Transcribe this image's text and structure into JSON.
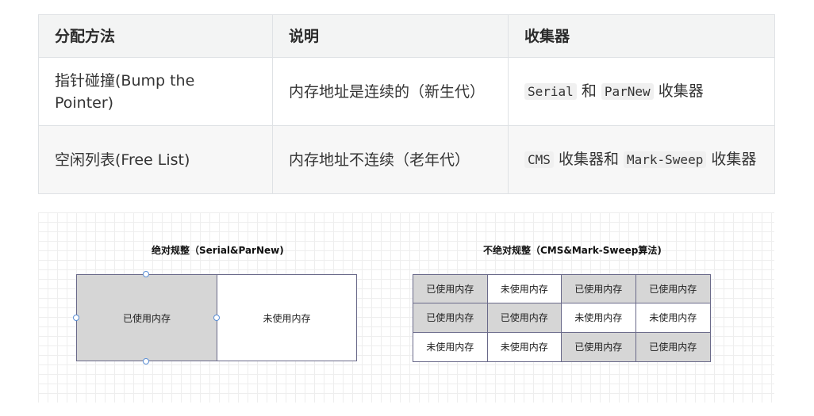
{
  "table": {
    "headers": [
      "分配方法",
      "说明",
      "收集器"
    ],
    "rows": [
      {
        "method": "指针碰撞(Bump the Pointer)",
        "desc": "内存地址是连续的（新生代）",
        "collector_code1": "Serial",
        "collector_text1": " 和 ",
        "collector_code2": "ParNew",
        "collector_text2": " 收集器"
      },
      {
        "method": "空闲列表(Free List)",
        "desc": "内存地址不连续（老年代）",
        "collector_code1": "CMS",
        "collector_text1": " 收集器和 ",
        "collector_code2": "Mark-Sweep",
        "collector_text2": " 收集器"
      }
    ]
  },
  "diagram": {
    "left_title": "绝对规整（Serial&ParNew)",
    "right_title": "不绝对规整（CMS&Mark-Sweep算法)",
    "used_label": "已使用内存",
    "free_label": "未使用内存",
    "colors": {
      "used": "#d6d6d6",
      "free": "#ffffff",
      "border": "#6a6a8a",
      "handle": "#5b8fd6"
    },
    "grid": [
      [
        "used",
        "free",
        "used",
        "used"
      ],
      [
        "used",
        "used",
        "free",
        "free"
      ],
      [
        "free",
        "free",
        "used",
        "used"
      ]
    ],
    "grid_labels": [
      [
        "已使用内存",
        "未使用内存",
        "已使用内存",
        "已使用内存"
      ],
      [
        "已使用内存",
        "已使用内存",
        "未使用内存",
        "未使用内存"
      ],
      [
        "未使用内存",
        "未使用内存",
        "已使用内存",
        "已使用内存"
      ]
    ]
  }
}
